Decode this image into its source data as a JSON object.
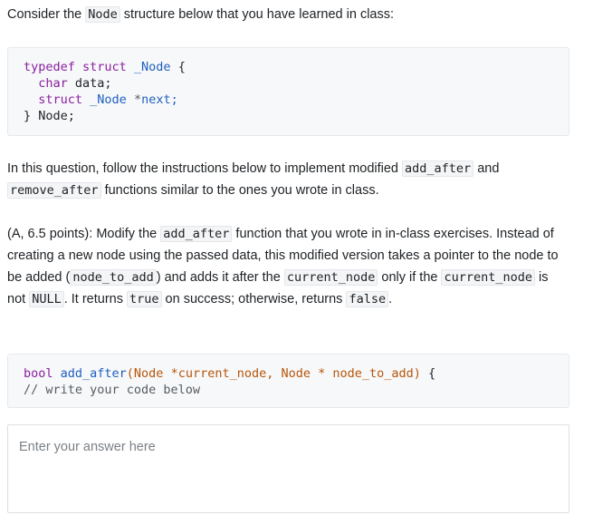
{
  "intro": {
    "t1": "Consider the ",
    "c1": "Node",
    "t2": " structure below that you have learned in class:"
  },
  "struct_code": {
    "l1_kw": "typedef struct ",
    "l1_ty": "_Node",
    "l1_end": " {",
    "l2_ty": "char",
    "l2_rest": " data;",
    "l3_kw": "struct ",
    "l3_ty": "_Node",
    "l3_op": " *",
    "l3_rest": "next;",
    "l4": "} Node;"
  },
  "question": {
    "t1": "In this question, follow the instructions below to implement modified ",
    "c1": "add_after",
    "t2": " and ",
    "c2": "remove_after",
    "t3": " functions similar to the ones you wrote in class."
  },
  "part_a": {
    "t1": "(A, 6.5 points): Modify the ",
    "c1": "add_after",
    "t2": " function that you wrote in in-class exercises. Instead of creating a new node using the passed data, this modified version takes a pointer to the node to be added (",
    "c2": "node_to_add",
    "t3": ") and adds it after the ",
    "c3": "current_node",
    "t4": " only if the ",
    "c4": "current_node",
    "t5": " is not ",
    "c5": "NULL",
    "t6": ". It returns ",
    "c6": "true",
    "t7": " on success; otherwise, returns ",
    "c7": "false",
    "t8": "."
  },
  "func_code": {
    "ret": "bool",
    "name": " add_after",
    "params": "(Node *current_node, Node * node_to_add)",
    "end": " {",
    "comment": "// write your code below"
  },
  "answer": {
    "placeholder": "Enter your answer here",
    "value": ""
  }
}
